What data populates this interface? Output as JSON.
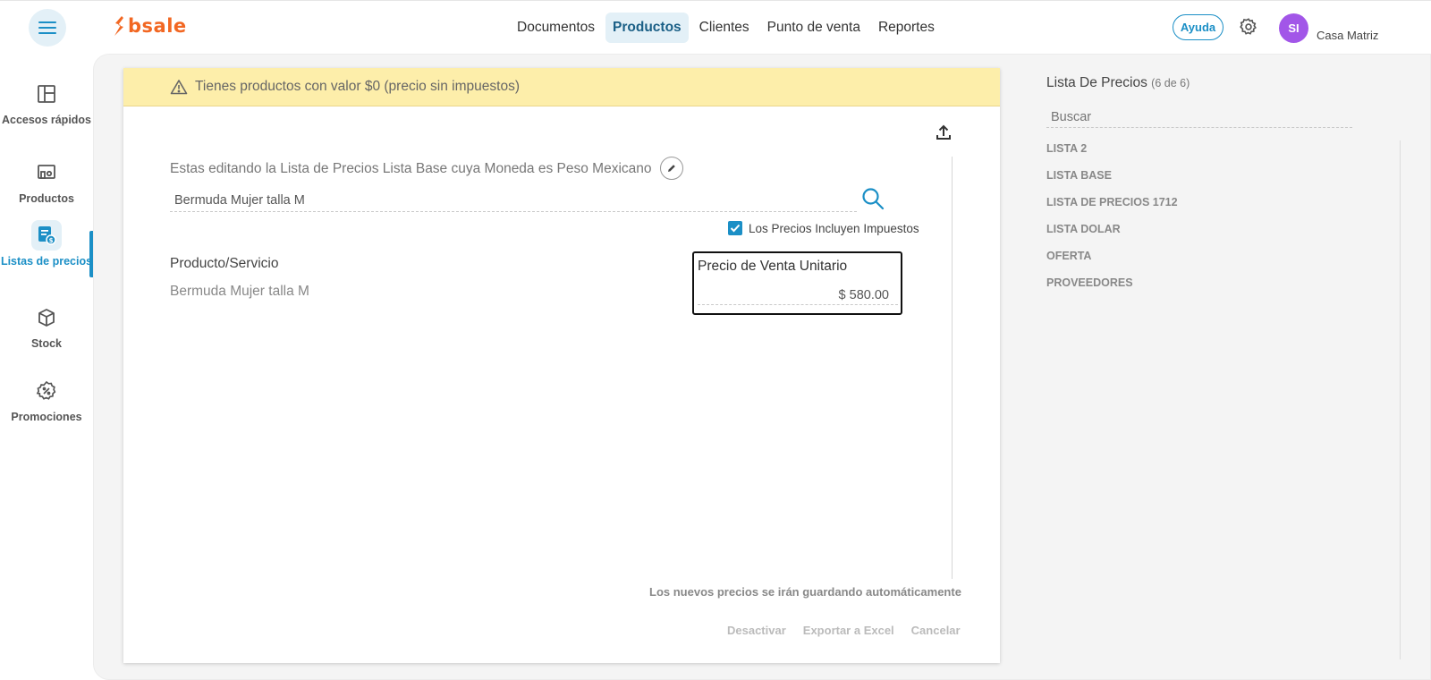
{
  "header": {
    "logo_text": "bsale",
    "nav": [
      "Documentos",
      "Productos",
      "Clientes",
      "Punto de venta",
      "Reportes"
    ],
    "active_nav": "Productos",
    "help_label": "Ayuda",
    "avatar_initials": "SI",
    "branch": "Casa Matriz",
    "icons": {
      "menu": "hamburger-icon",
      "settings": "gear-icon"
    }
  },
  "sidebar": {
    "items": [
      {
        "label": "Accesos rápidos",
        "icon": "layout-icon"
      },
      {
        "label": "Productos",
        "icon": "products-icon"
      },
      {
        "label": "Listas de precios",
        "icon": "price-list-icon",
        "active": true
      },
      {
        "label": "Stock",
        "icon": "box-icon"
      },
      {
        "label": "Promociones",
        "icon": "discount-badge-icon"
      }
    ]
  },
  "alert": {
    "text": "Tienes productos con valor $0 (precio sin impuestos)",
    "icon": "warning-icon"
  },
  "editor": {
    "editing_text": "Estas editando la Lista de Precios Lista Base cuya Moneda es Peso Mexicano",
    "search_value": "Bermuda Mujer talla M",
    "includes_taxes_label": "Los Precios Incluyen Impuestos",
    "includes_taxes_checked": true,
    "columns": {
      "product": "Producto/Servicio",
      "price": "Precio de Venta Unitario"
    },
    "rows": [
      {
        "product": "Bermuda Mujer talla M",
        "price": "$ 580.00"
      }
    ],
    "autosave_note": "Los nuevos precios se irán guardando automáticamente",
    "actions": {
      "deactivate": "Desactivar",
      "export": "Exportar a Excel",
      "cancel": "Cancelar"
    }
  },
  "price_lists": {
    "title": "Lista De Precios",
    "count": "(6 de 6)",
    "search_placeholder": "Buscar",
    "items": [
      "LISTA 2",
      "LISTA BASE",
      "LISTA DE PRECIOS 1712",
      "LISTA DOLAR",
      "OFERTA",
      "PROVEEDORES"
    ]
  },
  "colors": {
    "accent": "#1b8fc6",
    "brand": "#f26722",
    "alert_bg": "#fdeeaa",
    "avatar": "#a256e8"
  }
}
